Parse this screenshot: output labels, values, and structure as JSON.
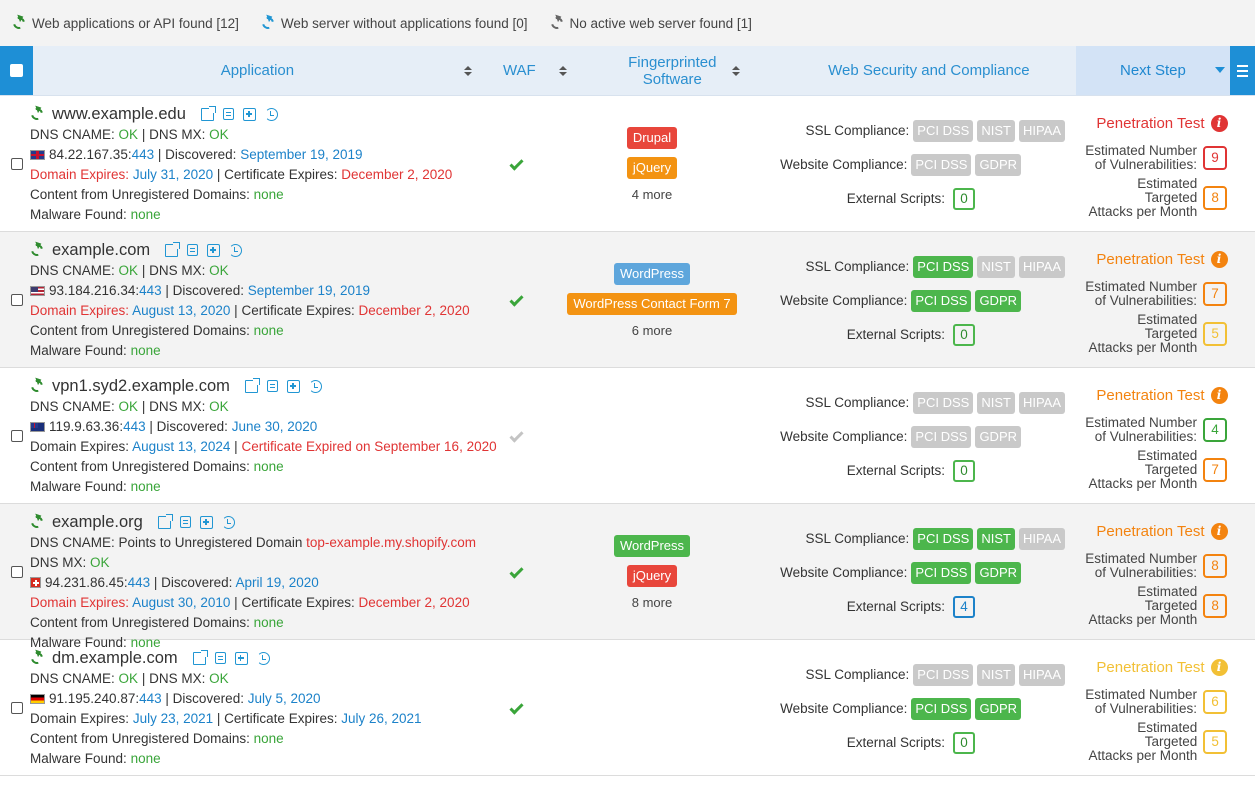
{
  "legend": [
    {
      "label": "Web applications or API found [12]",
      "color": "#2e8b2e"
    },
    {
      "label": "Web server without applications found [0]",
      "color": "#2196d3"
    },
    {
      "label": "No active web server found [1]",
      "color": "#666666"
    }
  ],
  "header": {
    "application": "Application",
    "waf": "WAF",
    "fingerprinted": "Fingerprinted Software",
    "web_security": "Web Security and Compliance",
    "next_step": "Next Step"
  },
  "labels": {
    "dns_cname": "DNS CNAME:",
    "dns_mx": "DNS MX:",
    "discovered": "Discovered:",
    "domain_expires": "Domain Expires:",
    "certificate_expires": "Certificate Expires:",
    "content_unregistered": "Content from Unregistered Domains:",
    "malware_found": "Malware Found:",
    "ssl_compliance": "SSL Compliance:",
    "website_compliance": "Website Compliance:",
    "external_scripts": "External Scripts:",
    "penetration_test": "Penetration Test",
    "est_vuln_1": "Estimated Number",
    "est_vuln_2": "of Vulnerabilities:",
    "est_att_1": "Estimated Targeted",
    "est_att_2": "Attacks per Month",
    "sep": "|",
    "pci": "PCI DSS",
    "nist": "NIST",
    "hipaa": "HIPAA",
    "gdpr": "GDPR"
  },
  "rows": [
    {
      "host": "www.example.edu",
      "dns_cname": "OK",
      "dns_mx": "OK",
      "flag": "uk",
      "ip": "84.22.167.35:",
      "port": "443",
      "discovered": "September 19, 2019",
      "domain_expires": "July 31, 2020",
      "cert_expires": "December 2, 2020",
      "content_unreg": "none",
      "malware": "none",
      "waf": true,
      "tags": [
        {
          "label": "Drupal",
          "color": "red"
        },
        {
          "label": "jQuery",
          "color": "orange"
        }
      ],
      "more": "4 more",
      "ssl": {
        "pci": false,
        "nist": false,
        "hipaa": false
      },
      "web": {
        "pci": false,
        "gdpr": false
      },
      "ext_scripts": "0",
      "pt_color": "red",
      "vuln": "9",
      "vuln_color": "red",
      "attacks": "8",
      "attacks_color": "orange"
    },
    {
      "host": "example.com",
      "dns_cname": "OK",
      "dns_mx": "OK",
      "flag": "us",
      "ip": "93.184.216.34:",
      "port": "443",
      "discovered": "September 19, 2019",
      "domain_expires": "August 13, 2020",
      "cert_expires": "December 2, 2020",
      "content_unreg": "none",
      "malware": "none",
      "waf": true,
      "tags": [
        {
          "label": "WordPress",
          "color": "blue"
        },
        {
          "label": "WordPress Contact Form 7",
          "color": "orange"
        }
      ],
      "more": "6 more",
      "ssl": {
        "pci": true,
        "nist": false,
        "hipaa": false
      },
      "web": {
        "pci": true,
        "gdpr": true
      },
      "ext_scripts": "0",
      "pt_color": "orange",
      "vuln": "7",
      "vuln_color": "orange",
      "attacks": "5",
      "attacks_color": "yellow"
    },
    {
      "host": "vpn1.syd2.example.com",
      "dns_cname": "OK",
      "dns_mx": "OK",
      "flag": "au",
      "ip": "119.9.63.36:",
      "port": "443",
      "discovered": "June 30, 2020",
      "domain_expires": "August 13, 2024",
      "cert_expires": "Certificate Expired on September 16, 2020",
      "content_unreg": "none",
      "malware": "none",
      "waf": false,
      "tags": [],
      "more": "",
      "ssl": {
        "pci": false,
        "nist": false,
        "hipaa": false
      },
      "web": {
        "pci": false,
        "gdpr": false
      },
      "ext_scripts": "0",
      "pt_color": "orange",
      "vuln": "4",
      "vuln_color": "green",
      "attacks": "7",
      "attacks_color": "orange"
    },
    {
      "host": "example.org",
      "dns_cname_text": "Points to Unregistered Domain",
      "dns_cname_link": "top-example.my.shopify.com",
      "dns_mx": "OK",
      "flag": "ch",
      "ip": "94.231.86.45:",
      "port": "443",
      "discovered": "April 19, 2020",
      "domain_expires": "August 30, 2010",
      "cert_expires": "December 2, 2020",
      "content_unreg": "none",
      "malware": "none",
      "waf": true,
      "tags": [
        {
          "label": "WordPress",
          "color": "green"
        },
        {
          "label": "jQuery",
          "color": "red"
        }
      ],
      "more": "8 more",
      "ssl": {
        "pci": true,
        "nist": true,
        "hipaa": false
      },
      "web": {
        "pci": true,
        "gdpr": true
      },
      "ext_scripts": "4",
      "pt_color": "orange",
      "vuln": "8",
      "vuln_color": "orange",
      "attacks": "8",
      "attacks_color": "orange"
    },
    {
      "host": "dm.example.com",
      "dns_cname": "OK",
      "dns_mx": "OK",
      "flag": "de",
      "ip": "91.195.240.87:",
      "port": "443",
      "discovered": "July 5, 2020",
      "domain_expires": "July 23, 2021",
      "cert_expires": "July 26, 2021",
      "content_unreg": "none",
      "malware": "none",
      "waf": true,
      "tags": [],
      "more": "",
      "ssl": {
        "pci": false,
        "nist": false,
        "hipaa": false
      },
      "web": {
        "pci": true,
        "gdpr": true
      },
      "ext_scripts": "0",
      "pt_color": "yellow",
      "vuln": "6",
      "vuln_color": "yellow",
      "attacks": "5",
      "attacks_color": "yellow"
    }
  ]
}
